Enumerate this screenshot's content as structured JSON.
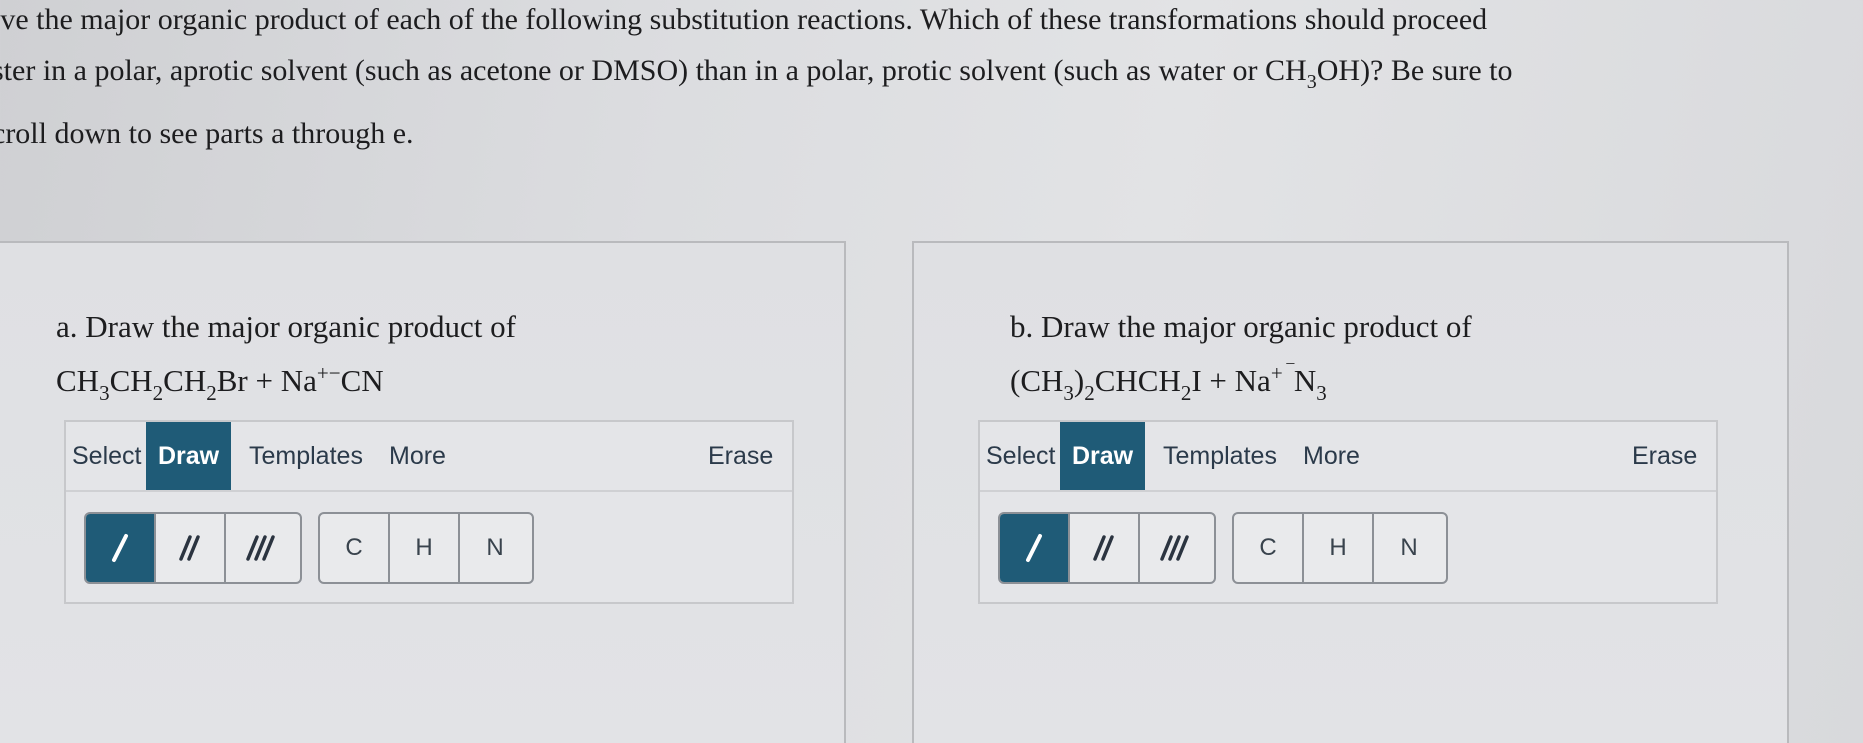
{
  "prompt": {
    "line1": "ive the major organic product of each of the following substitution reactions. Which of these transformations should proceed",
    "line2_before": "ster in a polar, aprotic solvent (such as acetone or DMSO) than in a polar, protic solvent (such as water or CH",
    "line2_sub": "3",
    "line2_after": "OH)? Be sure to",
    "line3": "croll down to see parts a through e."
  },
  "part_a": {
    "title": "a. Draw the major organic product of",
    "formula": [
      {
        "t": "CH",
        "s": "3"
      },
      {
        "t": "CH",
        "s": "2"
      },
      {
        "t": "CH",
        "s": "2"
      },
      {
        "t": "Br + Na"
      },
      {
        "sup": "+−"
      },
      {
        "t": "CN"
      }
    ]
  },
  "part_b": {
    "title": "b. Draw the major organic product of",
    "formula": [
      {
        "t": "(CH",
        "s": "3"
      },
      {
        "t": ")",
        "s": "2"
      },
      {
        "t": "CHCH",
        "s": "2"
      },
      {
        "t": "I + Na"
      },
      {
        "sup": "+ ‾"
      },
      {
        "t": "N",
        "s": "3"
      }
    ]
  },
  "editor": {
    "tabs": {
      "select": "Select",
      "draw": "Draw",
      "templates": "Templates",
      "more": "More",
      "erase": "Erase"
    },
    "bonds": {
      "single": "single-bond-icon",
      "double": "double-bond-icon",
      "triple": "triple-bond-icon"
    },
    "atoms": [
      "C",
      "H",
      "N"
    ]
  },
  "colors": {
    "accent": "#1f5b77",
    "text": "#1d1d1f",
    "panel_border": "#b9babd"
  }
}
